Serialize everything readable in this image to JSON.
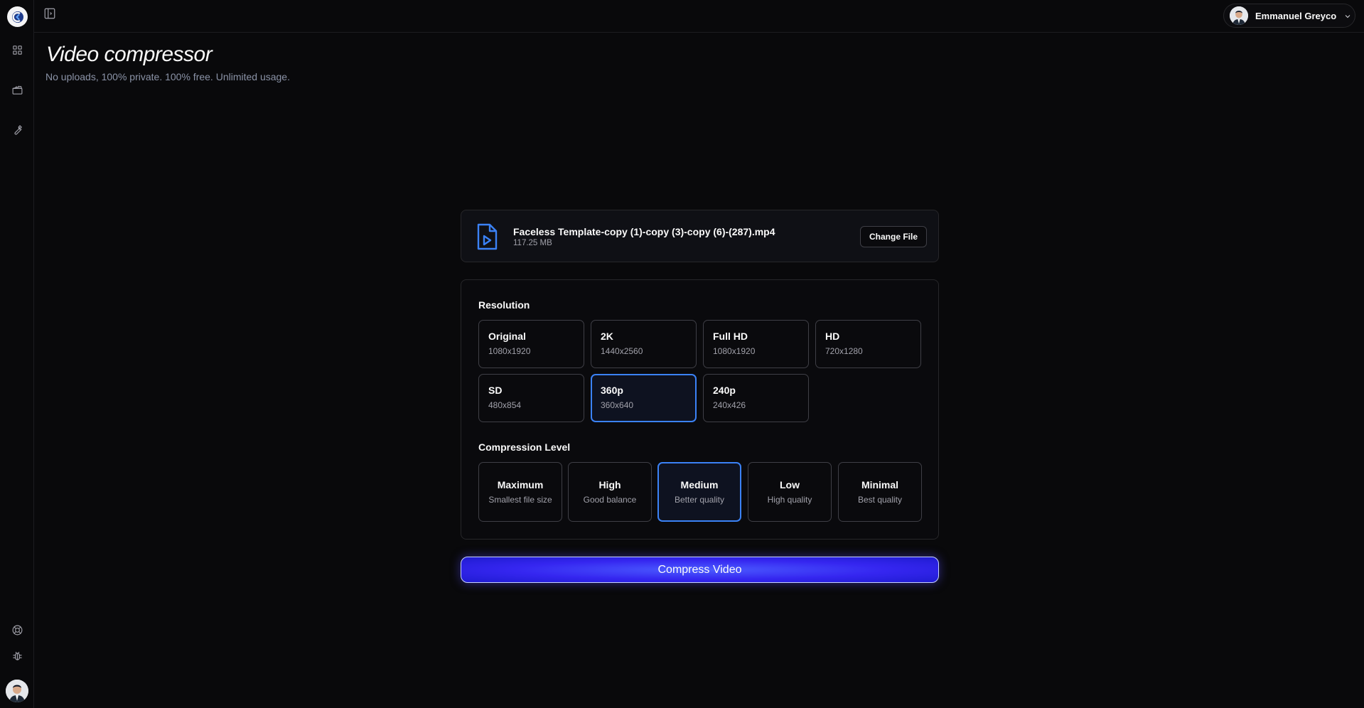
{
  "topbar": {
    "user_name": "Emmanuel Greyco"
  },
  "header": {
    "title": "Video compressor",
    "subtitle": "No uploads, 100% private. 100% free. Unlimited usage."
  },
  "file": {
    "name": "Faceless Template-copy (1)-copy (3)-copy (6)-(287).mp4",
    "size": "117.25 MB",
    "change_label": "Change File"
  },
  "resolution": {
    "label": "Resolution",
    "selected": "360p",
    "options": [
      {
        "title": "Original",
        "dims": "1080x1920"
      },
      {
        "title": "2K",
        "dims": "1440x2560"
      },
      {
        "title": "Full HD",
        "dims": "1080x1920"
      },
      {
        "title": "HD",
        "dims": "720x1280"
      },
      {
        "title": "SD",
        "dims": "480x854"
      },
      {
        "title": "360p",
        "dims": "360x640"
      },
      {
        "title": "240p",
        "dims": "240x426"
      }
    ]
  },
  "compression": {
    "label": "Compression Level",
    "selected": "Medium",
    "options": [
      {
        "title": "Maximum",
        "desc": "Smallest file size"
      },
      {
        "title": "High",
        "desc": "Good balance"
      },
      {
        "title": "Medium",
        "desc": "Better quality"
      },
      {
        "title": "Low",
        "desc": "High quality"
      },
      {
        "title": "Minimal",
        "desc": "Best quality"
      }
    ]
  },
  "action": {
    "compress_label": "Compress Video"
  },
  "colors": {
    "background": "#09090b",
    "accent": "#3b82f6",
    "button": "#3526f0"
  },
  "icons": {
    "sidebar_top": [
      "app-logo-icon",
      "dashboard-grid-icon",
      "clapperboard-icon",
      "wrench-icon"
    ],
    "sidebar_bottom": [
      "lifebuoy-icon",
      "bug-icon"
    ]
  }
}
